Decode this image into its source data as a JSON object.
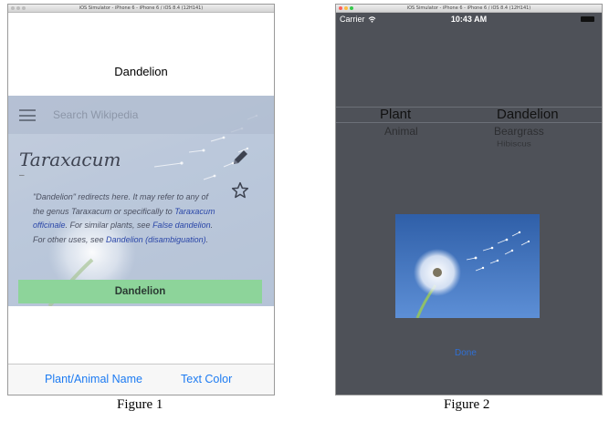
{
  "figure1": {
    "window_title": "iOS Simulator - iPhone 6 - iPhone 6 / iOS 8.4 (12H141)",
    "title": "Dandelion",
    "search": {
      "placeholder": "Search Wikipedia"
    },
    "article": {
      "title": "Taraxacum",
      "dash": "–",
      "body_parts": [
        {
          "text": "\"Dandelion\" redirects here. It may refer to any of the genus Taraxacum or specifically to ",
          "link": false
        },
        {
          "text": "Taraxacum officinale",
          "link": true
        },
        {
          "text": ". For similar plants, see ",
          "link": false
        },
        {
          "text": "False dandelion",
          "link": true
        },
        {
          "text": ". For other uses, see ",
          "link": false
        },
        {
          "text": "Dandelion (disambiguation)",
          "link": true
        },
        {
          "text": ".",
          "link": false
        }
      ]
    },
    "button_label": "Dandelion",
    "toolbar": {
      "left": "Plant/Animal Name",
      "right": "Text Color"
    },
    "caption": "Figure 1"
  },
  "figure2": {
    "window_title": "iOS Simulator - iPhone 6 - iPhone 6 / iOS 8.4 (12H141)",
    "status": {
      "carrier": "Carrier",
      "time": "10:43 AM"
    },
    "picker": {
      "column1": [
        "Plant",
        "Animal"
      ],
      "column2": [
        "Dandelion",
        "Beargrass",
        "Hibiscus"
      ]
    },
    "done_label": "Done",
    "caption": "Figure 2"
  },
  "colors": {
    "accent": "#1d7bf2",
    "wiki_button": "#8dd49a",
    "sim_background": "#4e5158"
  }
}
